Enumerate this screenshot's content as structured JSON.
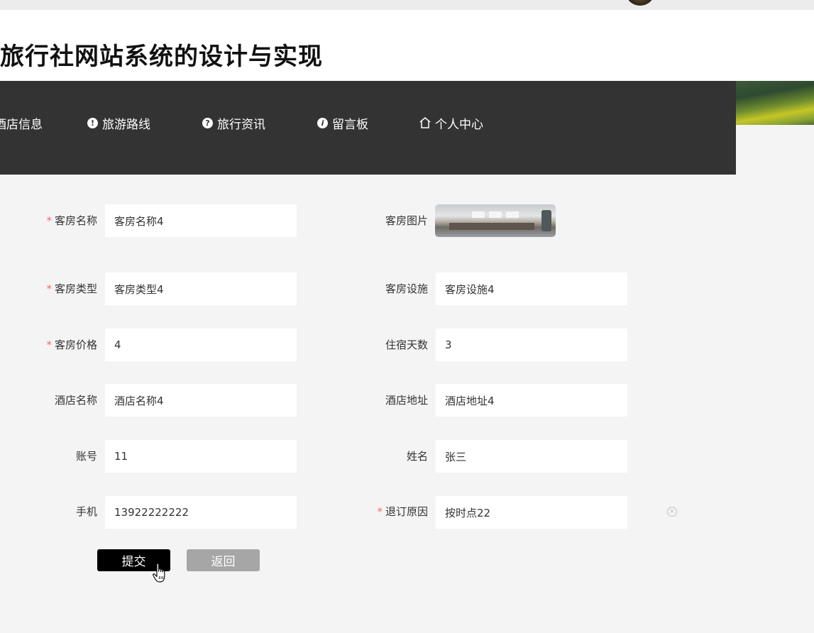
{
  "header": {
    "title": "旅行社网站系统的设计与实现"
  },
  "nav": {
    "items": [
      {
        "label": "酒店信息"
      },
      {
        "label": "旅游路线"
      },
      {
        "label": "旅行资讯"
      },
      {
        "label": "留言板"
      },
      {
        "label": "个人中心"
      }
    ]
  },
  "form": {
    "room_name": {
      "label": "客房名称",
      "value": "客房名称4",
      "required": true
    },
    "room_image": {
      "label": "客房图片"
    },
    "room_type": {
      "label": "客房类型",
      "value": "客房类型4",
      "required": true
    },
    "room_facilities": {
      "label": "客房设施",
      "value": "客房设施4"
    },
    "room_price": {
      "label": "客房价格",
      "value": "4",
      "required": true
    },
    "stay_days": {
      "label": "住宿天数",
      "value": "3"
    },
    "hotel_name": {
      "label": "酒店名称",
      "value": "酒店名称4"
    },
    "hotel_address": {
      "label": "酒店地址",
      "value": "酒店地址4"
    },
    "account": {
      "label": "账号",
      "value": "11"
    },
    "name": {
      "label": "姓名",
      "value": "张三"
    },
    "phone": {
      "label": "手机",
      "value": "13922222222"
    },
    "cancel_reason": {
      "label": "退订原因",
      "value": "按时点22",
      "required": true
    },
    "submit_label": "提交",
    "back_label": "返回"
  },
  "icons": {
    "nav_route": "exclamation-circle-icon",
    "nav_news": "question-circle-icon",
    "nav_message": "info-circle-icon",
    "nav_personal": "home-icon",
    "clear": "circle-close-icon",
    "cursor": "hand-pointer-icon"
  },
  "colors": {
    "nav_bg": "#333333",
    "required_mark": "#f56c6c",
    "submit_bg": "#000000",
    "back_bg": "#a6a6a6",
    "page_bg": "#f4f4f4"
  }
}
